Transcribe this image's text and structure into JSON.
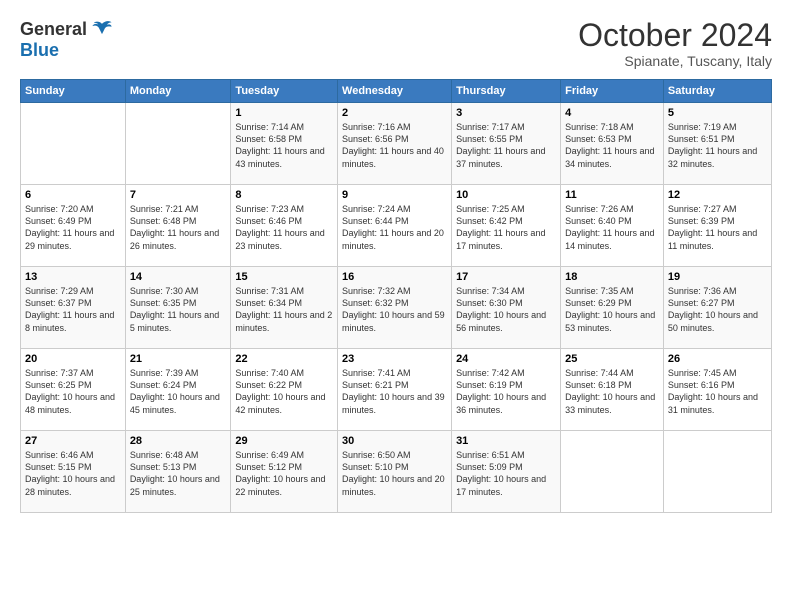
{
  "logo": {
    "general": "General",
    "blue": "Blue"
  },
  "header": {
    "month": "October 2024",
    "location": "Spianate, Tuscany, Italy"
  },
  "days_of_week": [
    "Sunday",
    "Monday",
    "Tuesday",
    "Wednesday",
    "Thursday",
    "Friday",
    "Saturday"
  ],
  "weeks": [
    [
      {
        "day": "",
        "info": ""
      },
      {
        "day": "",
        "info": ""
      },
      {
        "day": "1",
        "info": "Sunrise: 7:14 AM\nSunset: 6:58 PM\nDaylight: 11 hours and 43 minutes."
      },
      {
        "day": "2",
        "info": "Sunrise: 7:16 AM\nSunset: 6:56 PM\nDaylight: 11 hours and 40 minutes."
      },
      {
        "day": "3",
        "info": "Sunrise: 7:17 AM\nSunset: 6:55 PM\nDaylight: 11 hours and 37 minutes."
      },
      {
        "day": "4",
        "info": "Sunrise: 7:18 AM\nSunset: 6:53 PM\nDaylight: 11 hours and 34 minutes."
      },
      {
        "day": "5",
        "info": "Sunrise: 7:19 AM\nSunset: 6:51 PM\nDaylight: 11 hours and 32 minutes."
      }
    ],
    [
      {
        "day": "6",
        "info": "Sunrise: 7:20 AM\nSunset: 6:49 PM\nDaylight: 11 hours and 29 minutes."
      },
      {
        "day": "7",
        "info": "Sunrise: 7:21 AM\nSunset: 6:48 PM\nDaylight: 11 hours and 26 minutes."
      },
      {
        "day": "8",
        "info": "Sunrise: 7:23 AM\nSunset: 6:46 PM\nDaylight: 11 hours and 23 minutes."
      },
      {
        "day": "9",
        "info": "Sunrise: 7:24 AM\nSunset: 6:44 PM\nDaylight: 11 hours and 20 minutes."
      },
      {
        "day": "10",
        "info": "Sunrise: 7:25 AM\nSunset: 6:42 PM\nDaylight: 11 hours and 17 minutes."
      },
      {
        "day": "11",
        "info": "Sunrise: 7:26 AM\nSunset: 6:40 PM\nDaylight: 11 hours and 14 minutes."
      },
      {
        "day": "12",
        "info": "Sunrise: 7:27 AM\nSunset: 6:39 PM\nDaylight: 11 hours and 11 minutes."
      }
    ],
    [
      {
        "day": "13",
        "info": "Sunrise: 7:29 AM\nSunset: 6:37 PM\nDaylight: 11 hours and 8 minutes."
      },
      {
        "day": "14",
        "info": "Sunrise: 7:30 AM\nSunset: 6:35 PM\nDaylight: 11 hours and 5 minutes."
      },
      {
        "day": "15",
        "info": "Sunrise: 7:31 AM\nSunset: 6:34 PM\nDaylight: 11 hours and 2 minutes."
      },
      {
        "day": "16",
        "info": "Sunrise: 7:32 AM\nSunset: 6:32 PM\nDaylight: 10 hours and 59 minutes."
      },
      {
        "day": "17",
        "info": "Sunrise: 7:34 AM\nSunset: 6:30 PM\nDaylight: 10 hours and 56 minutes."
      },
      {
        "day": "18",
        "info": "Sunrise: 7:35 AM\nSunset: 6:29 PM\nDaylight: 10 hours and 53 minutes."
      },
      {
        "day": "19",
        "info": "Sunrise: 7:36 AM\nSunset: 6:27 PM\nDaylight: 10 hours and 50 minutes."
      }
    ],
    [
      {
        "day": "20",
        "info": "Sunrise: 7:37 AM\nSunset: 6:25 PM\nDaylight: 10 hours and 48 minutes."
      },
      {
        "day": "21",
        "info": "Sunrise: 7:39 AM\nSunset: 6:24 PM\nDaylight: 10 hours and 45 minutes."
      },
      {
        "day": "22",
        "info": "Sunrise: 7:40 AM\nSunset: 6:22 PM\nDaylight: 10 hours and 42 minutes."
      },
      {
        "day": "23",
        "info": "Sunrise: 7:41 AM\nSunset: 6:21 PM\nDaylight: 10 hours and 39 minutes."
      },
      {
        "day": "24",
        "info": "Sunrise: 7:42 AM\nSunset: 6:19 PM\nDaylight: 10 hours and 36 minutes."
      },
      {
        "day": "25",
        "info": "Sunrise: 7:44 AM\nSunset: 6:18 PM\nDaylight: 10 hours and 33 minutes."
      },
      {
        "day": "26",
        "info": "Sunrise: 7:45 AM\nSunset: 6:16 PM\nDaylight: 10 hours and 31 minutes."
      }
    ],
    [
      {
        "day": "27",
        "info": "Sunrise: 6:46 AM\nSunset: 5:15 PM\nDaylight: 10 hours and 28 minutes."
      },
      {
        "day": "28",
        "info": "Sunrise: 6:48 AM\nSunset: 5:13 PM\nDaylight: 10 hours and 25 minutes."
      },
      {
        "day": "29",
        "info": "Sunrise: 6:49 AM\nSunset: 5:12 PM\nDaylight: 10 hours and 22 minutes."
      },
      {
        "day": "30",
        "info": "Sunrise: 6:50 AM\nSunset: 5:10 PM\nDaylight: 10 hours and 20 minutes."
      },
      {
        "day": "31",
        "info": "Sunrise: 6:51 AM\nSunset: 5:09 PM\nDaylight: 10 hours and 17 minutes."
      },
      {
        "day": "",
        "info": ""
      },
      {
        "day": "",
        "info": ""
      }
    ]
  ]
}
